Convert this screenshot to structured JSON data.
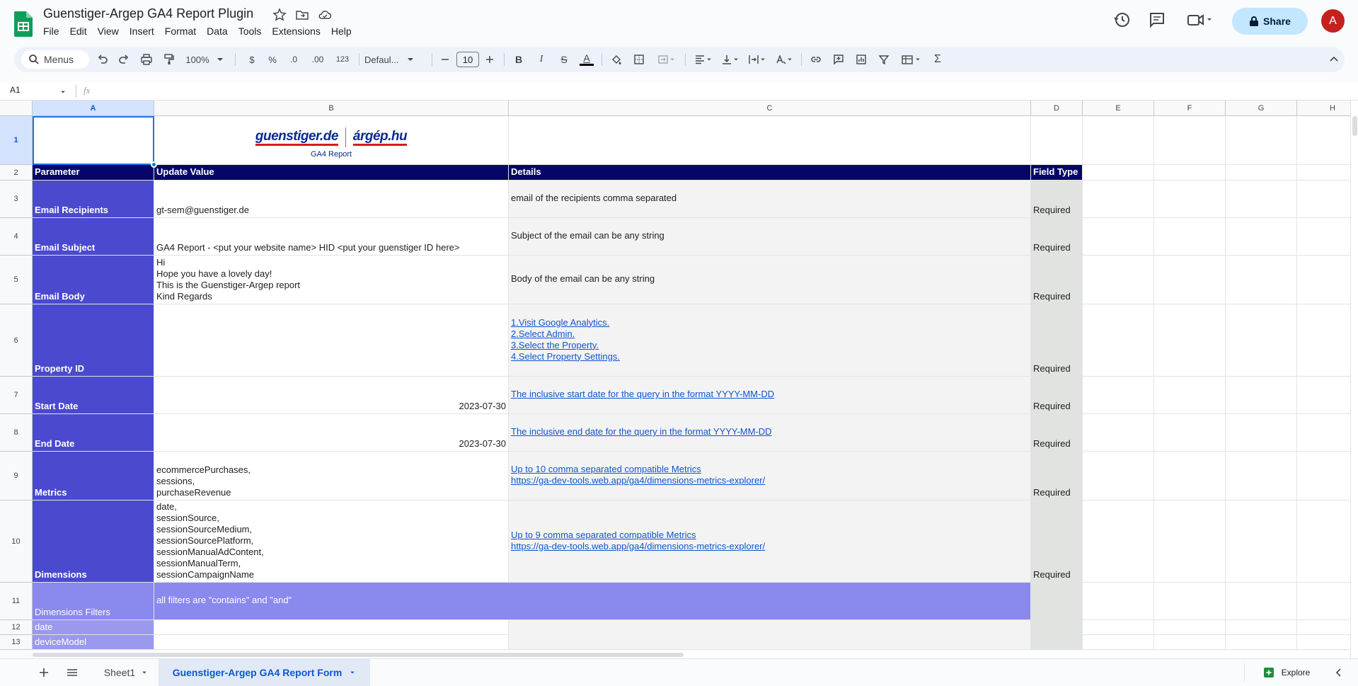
{
  "app": {
    "title": "Guenstiger-Argep GA4 Report Plugin",
    "menus": [
      "File",
      "Edit",
      "View",
      "Insert",
      "Format",
      "Data",
      "Tools",
      "Extensions",
      "Help"
    ],
    "share_label": "Share",
    "avatar_letter": "A"
  },
  "toolbar": {
    "search_label": "Menus",
    "zoom": "100%",
    "currency": "$",
    "percent": "%",
    "decrease_decimal": ".0",
    "increase_decimal": ".00",
    "number_format": "123",
    "font_name": "Defaul...",
    "font_size": "10",
    "bold": "B",
    "italic": "I",
    "strike": "S",
    "text_color": "A",
    "sum": "Σ"
  },
  "formula_bar": {
    "cell_ref": "A1",
    "fx": "fx"
  },
  "columns": [
    "A",
    "B",
    "C",
    "D",
    "E",
    "F",
    "G",
    "H"
  ],
  "header_image": {
    "brand_left": "guenstiger.de",
    "brand_right": "árgép.hu",
    "subtitle": "GA4 Report"
  },
  "table_header": {
    "a": "Parameter",
    "b": "Update Value",
    "c": "Details",
    "d": "Field Type"
  },
  "rows": [
    {
      "num": "3",
      "a": "Email Recipients",
      "b": [
        "gt-sem@guenstiger.de"
      ],
      "c": [
        "email of the recipients comma separated"
      ],
      "c_link": false,
      "d": "Required"
    },
    {
      "num": "4",
      "a": "Email Subject",
      "b": [
        "GA4 Report - <put your website name> HID <put your guenstiger ID here>"
      ],
      "c": [
        "Subject of the email can be any string"
      ],
      "c_link": false,
      "d": "Required"
    },
    {
      "num": "5",
      "a": "Email Body",
      "b": [
        "Hi",
        "Hope you have a lovely day!",
        "This is the Guenstiger-Argep report",
        "Kind Regards"
      ],
      "c": [
        "Body of the email can be any string"
      ],
      "c_link": false,
      "d": "Required"
    },
    {
      "num": "6",
      "a": "Property ID",
      "b": [],
      "c": [
        "1.Visit Google Analytics.",
        "2.Select Admin.",
        "3.Select the Property.",
        "4.Select Property Settings."
      ],
      "c_link": true,
      "d": "Required"
    },
    {
      "num": "7",
      "a": "Start Date",
      "b": [
        "2023-07-30"
      ],
      "b_right": true,
      "c": [
        "The inclusive start date for the query in the format YYYY-MM-DD"
      ],
      "c_link": true,
      "d": "Required"
    },
    {
      "num": "8",
      "a": "End Date",
      "b": [
        "2023-07-30"
      ],
      "b_right": true,
      "c": [
        "The inclusive end date for the query in the format YYYY-MM-DD"
      ],
      "c_link": true,
      "d": "Required"
    },
    {
      "num": "9",
      "a": "Metrics",
      "b": [
        "ecommercePurchases,",
        "sessions,",
        "purchaseRevenue"
      ],
      "c": [
        "Up to 10 comma separated compatible Metrics",
        "https://ga-dev-tools.web.app/ga4/dimensions-metrics-explorer/"
      ],
      "c_link": true,
      "d": "Required"
    },
    {
      "num": "10",
      "a": "Dimensions",
      "b": [
        "date,",
        "sessionSource,",
        "sessionSourceMedium,",
        "sessionSourcePlatform,",
        "sessionManualAdContent,",
        "sessionManualTerm,",
        "sessionCampaignName"
      ],
      "c": [
        "Up to 9 comma separated compatible Metrics",
        "https://ga-dev-tools.web.app/ga4/dimensions-metrics-explorer/"
      ],
      "c_link": true,
      "d": "Required"
    }
  ],
  "row11": {
    "num": "11",
    "a": "Dimensions Filters",
    "b": "all filters are \"contains\" and \"and\""
  },
  "row12": {
    "num": "12",
    "a": "date"
  },
  "row13": {
    "num": "13",
    "a": "deviceModel"
  },
  "row_nums": {
    "r1": "1",
    "r2": "2"
  },
  "sheets": {
    "sheet1": "Sheet1",
    "active": "Guenstiger-Argep GA4 Report Form",
    "explore": "Explore"
  },
  "colors": {
    "param_col": "#4b4ace",
    "header_row": "#06066a",
    "filter_row": "#8a89ee",
    "link": "#1155cc"
  }
}
